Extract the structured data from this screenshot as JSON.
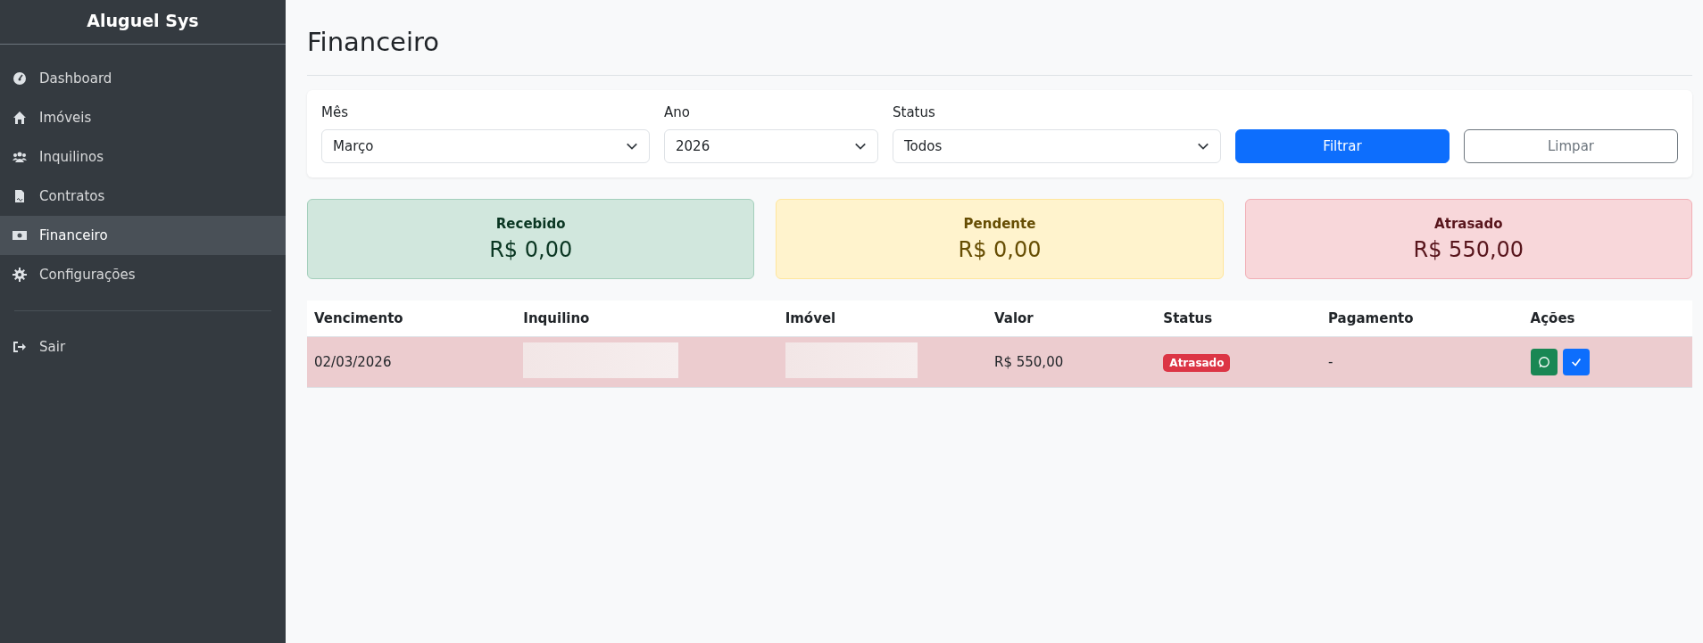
{
  "sidebar": {
    "brand": "Aluguel Sys",
    "items": [
      {
        "label": "Dashboard",
        "selected": false
      },
      {
        "label": "Imóveis",
        "selected": false
      },
      {
        "label": "Inquilinos",
        "selected": false
      },
      {
        "label": "Contratos",
        "selected": false
      },
      {
        "label": "Financeiro",
        "selected": true
      },
      {
        "label": "Configurações",
        "selected": false
      }
    ],
    "logout": {
      "label": "Sair"
    }
  },
  "page": {
    "title": "Financeiro"
  },
  "filters": {
    "fields": [
      {
        "label": "Mês",
        "value": "Março"
      },
      {
        "label": "Ano",
        "value": "2026"
      },
      {
        "label": "Status",
        "value": "Todos"
      }
    ],
    "buttons": [
      {
        "label": "Filtrar",
        "kind": "primary"
      },
      {
        "label": "Limpar",
        "kind": "outline"
      }
    ]
  },
  "summary": [
    {
      "label": "Recebido",
      "amount": "R$ 0,00",
      "kind": "success"
    },
    {
      "label": "Pendente",
      "amount": "R$ 0,00",
      "kind": "warning"
    },
    {
      "label": "Atrasado",
      "amount": "R$ 550,00",
      "kind": "danger"
    }
  ],
  "table": {
    "columns": [
      "Vencimento",
      "Inquilino",
      "Imóvel",
      "Valor",
      "Status",
      "Pagamento",
      "Ações"
    ],
    "rows": [
      {
        "vencimento": "02/03/2026",
        "valor": "R$ 550,00",
        "status": {
          "label": "Atrasado",
          "kind": "danger"
        },
        "pagamento": "-"
      }
    ]
  }
}
